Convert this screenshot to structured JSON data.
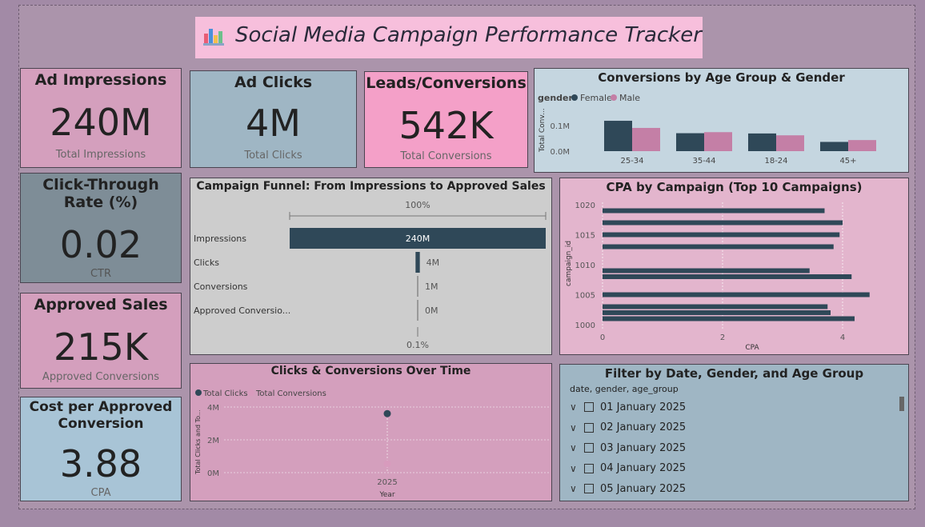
{
  "header": {
    "title": "Social Media Campaign Performance Tracker",
    "suffix": ".",
    "icon": "bar-chart-icon"
  },
  "kpis": {
    "impressions": {
      "title": "Ad Impressions",
      "value": "240M",
      "sub": "Total Impressions",
      "bg": "#d49fbd"
    },
    "clicks": {
      "title": "Ad Clicks",
      "value": "4M",
      "sub": "Total Clicks",
      "bg": "#9fb6c4"
    },
    "leads": {
      "title": "Leads/Conversions",
      "value": "542K",
      "sub": "Total Conversions",
      "bg": "#f4a0c8"
    },
    "ctr": {
      "title": "Click-Through Rate (%)",
      "value": "0.02",
      "sub": "CTR",
      "bg": "#7e8d97"
    },
    "approved": {
      "title": "Approved Sales",
      "value": "215K",
      "sub": "Approved Conversions",
      "bg": "#d49fbd"
    },
    "cpa": {
      "title": "Cost per Approved Conversion",
      "value": "3.88",
      "sub": "CPA",
      "bg": "#a8c4d6"
    }
  },
  "age_gender": {
    "title": "Conversions by Age Group & Gender",
    "legend_title": "gender",
    "ylabel": "Total Conv...",
    "yticks": [
      "0.1M",
      "0.0M"
    ]
  },
  "funnel": {
    "title": "Campaign Funnel: From Impressions to Approved Sales",
    "top_label": "100%",
    "bottom_label": "0.1%"
  },
  "cpa_chart": {
    "title": "CPA by Campaign (Top 10 Campaigns)",
    "xlabel": "CPA",
    "ylabel": "campaign_id",
    "xticks": [
      "0",
      "2",
      "4"
    ],
    "yticks": [
      "1020",
      "1015",
      "1010",
      "1005",
      "1000"
    ]
  },
  "time_chart": {
    "title": "Clicks & Conversions Over Time",
    "xlabel": "Year",
    "ylabel": "Total Clicks and To...",
    "yticks": [
      "4M",
      "2M",
      "0M"
    ]
  },
  "slicer": {
    "title": "Filter by Date, Gender, and Age Group",
    "field": "date, gender, age_group",
    "items": [
      "01 January 2025",
      "02 January 2025",
      "03 January 2025",
      "04 January 2025",
      "05 January 2025"
    ]
  },
  "colors": {
    "female": "#2f4858",
    "male": "#c47fa6",
    "clicks": "#2f4858",
    "conversions": "#d89bbd"
  },
  "chart_data": [
    {
      "type": "bar",
      "title": "Conversions by Age Group & Gender",
      "categories": [
        "25-34",
        "35-44",
        "18-24",
        "45+"
      ],
      "series": [
        {
          "name": "Female",
          "values": [
            0.115,
            0.068,
            0.067,
            0.035
          ]
        },
        {
          "name": "Male",
          "values": [
            0.088,
            0.072,
            0.06,
            0.042
          ]
        }
      ],
      "ylim": [
        0,
        0.14
      ],
      "units": "M"
    },
    {
      "type": "bar",
      "title": "Campaign Funnel: From Impressions to Approved Sales",
      "categories": [
        "Impressions",
        "Clicks",
        "Conversions",
        "Approved Conversio..."
      ],
      "values": [
        240,
        4,
        1,
        0
      ],
      "labels": [
        "240M",
        "4M",
        "1M",
        "0M"
      ]
    },
    {
      "type": "bar",
      "title": "CPA by Campaign (Top 10 Campaigns)",
      "campaign_ids": [
        1019,
        1017,
        1015,
        1013,
        1009,
        1008,
        1005,
        1003,
        1002,
        1001
      ],
      "values": [
        3.7,
        4.0,
        3.95,
        3.85,
        3.45,
        4.15,
        4.45,
        3.75,
        3.8,
        4.2
      ],
      "xlim": [
        0,
        4.6
      ],
      "ylim": [
        999,
        1021
      ]
    },
    {
      "type": "scatter",
      "title": "Clicks & Conversions Over Time",
      "x": [
        "2025"
      ],
      "series": [
        {
          "name": "Total Clicks",
          "values": [
            3.6
          ]
        },
        {
          "name": "Total Conversions",
          "values": [
            0.54
          ]
        }
      ],
      "ylim": [
        0,
        4.5
      ],
      "units": "M"
    }
  ]
}
